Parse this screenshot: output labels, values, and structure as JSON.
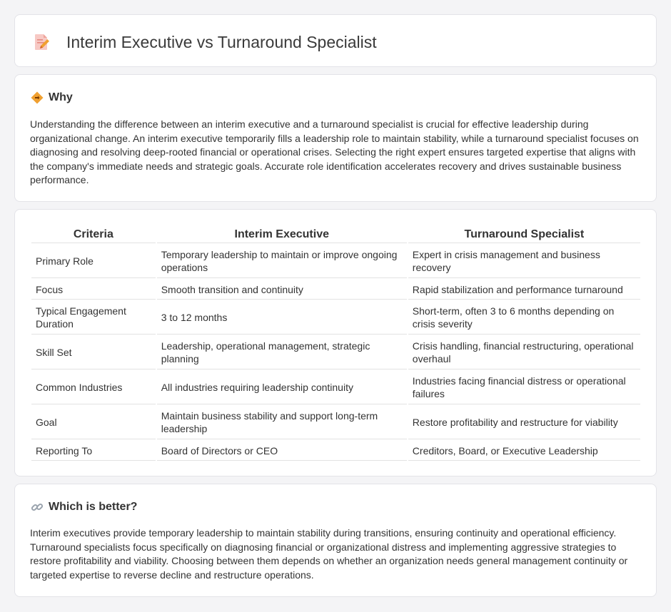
{
  "header": {
    "title": "Interim Executive vs Turnaround Specialist",
    "icon": "document-pencil-icon"
  },
  "why": {
    "heading": "Why",
    "icon": "diamond-signpost-icon",
    "text": "Understanding the difference between an interim executive and a turnaround specialist is crucial for effective leadership during organizational change. An interim executive temporarily fills a leadership role to maintain stability, while a turnaround specialist focuses on diagnosing and resolving deep-rooted financial or operational crises. Selecting the right expert ensures targeted expertise that aligns with the company's immediate needs and strategic goals. Accurate role identification accelerates recovery and drives sustainable business performance."
  },
  "comparison": {
    "columns": [
      "Criteria",
      "Interim Executive",
      "Turnaround Specialist"
    ],
    "rows": [
      [
        "Primary Role",
        "Temporary leadership to maintain or improve ongoing operations",
        "Expert in crisis management and business recovery"
      ],
      [
        "Focus",
        "Smooth transition and continuity",
        "Rapid stabilization and performance turnaround"
      ],
      [
        "Typical Engagement Duration",
        "3 to 12 months",
        "Short-term, often 3 to 6 months depending on crisis severity"
      ],
      [
        "Skill Set",
        "Leadership, operational management, strategic planning",
        "Crisis handling, financial restructuring, operational overhaul"
      ],
      [
        "Common Industries",
        "All industries requiring leadership continuity",
        "Industries facing financial distress or operational failures"
      ],
      [
        "Goal",
        "Maintain business stability and support long-term leadership",
        "Restore profitability and restructure for viability"
      ],
      [
        "Reporting To",
        "Board of Directors or CEO",
        "Creditors, Board, or Executive Leadership"
      ]
    ]
  },
  "better": {
    "heading": "Which is better?",
    "icon": "link-icon",
    "text": "Interim executives provide temporary leadership to maintain stability during transitions, ensuring continuity and operational efficiency. Turnaround specialists focus specifically on diagnosing financial or organizational distress and implementing aggressive strategies to restore profitability and viability. Choosing between them depends on whether an organization needs general management continuity or targeted expertise to reverse decline and restructure operations."
  },
  "colors": {
    "background": "#f4f4f6",
    "card": "#ffffff",
    "accent_orange": "#f0a030",
    "icon_pink": "#e86a6a"
  }
}
